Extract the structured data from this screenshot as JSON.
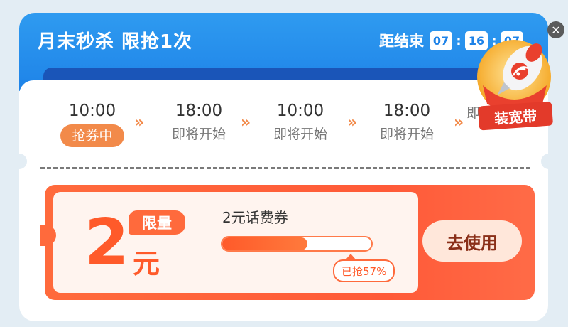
{
  "header": {
    "title": "月末秒杀  限抢1次",
    "countdown": {
      "label": "距结束",
      "hours": "07",
      "minutes": "16",
      "seconds": "07",
      "separator": ":"
    }
  },
  "schedule": [
    {
      "time": "10:00",
      "status": "抢券中",
      "active": true
    },
    {
      "time": "18:00",
      "status": "即将开始",
      "active": false
    },
    {
      "time": "10:00",
      "status": "即将开始",
      "active": false
    },
    {
      "time": "18:00",
      "status": "即将开始",
      "active": false
    },
    {
      "time": "",
      "status": "即将开",
      "active": false
    }
  ],
  "chevron": "»",
  "coupon": {
    "amount": "2",
    "unit": "元",
    "limit_badge": "限量",
    "name": "2元话费券",
    "progress": 0.57,
    "grabbed_label": "已抢57%",
    "use_button": "去使用"
  },
  "promo": {
    "label": "装宽带",
    "icon": "rocket-icon"
  },
  "close_icon": "✕",
  "colors": {
    "header_blue": "#2f9bf0",
    "accent_orange": "#ff5a2a",
    "promo_red": "#e33a2a"
  }
}
